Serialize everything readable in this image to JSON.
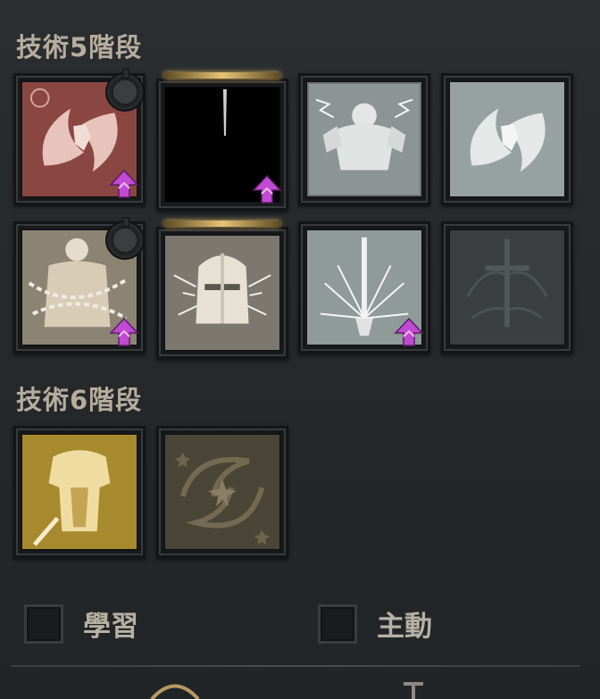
{
  "sections": [
    {
      "title": "技術5階段"
    },
    {
      "title": "技術6階段"
    }
  ],
  "skills_tier5": [
    {
      "name": "dragon-slash-skill-icon",
      "state": "active",
      "upgradable": true,
      "ring": true
    },
    {
      "name": "dark-blade-skill-icon",
      "state": "selected",
      "upgradable": true,
      "ring": false
    },
    {
      "name": "warrior-roar-skill-icon",
      "state": "available",
      "upgradable": false,
      "ring": false
    },
    {
      "name": "dragon-slash-alt-skill-icon",
      "state": "available",
      "upgradable": false,
      "ring": false
    },
    {
      "name": "chained-prisoner-skill-icon",
      "state": "active",
      "upgradable": true,
      "ring": true
    },
    {
      "name": "knight-helm-skill-icon",
      "state": "selected",
      "upgradable": false,
      "ring": false
    },
    {
      "name": "radiant-sword-skill-icon",
      "state": "available",
      "upgradable": true,
      "ring": false
    },
    {
      "name": "thorn-sword-skill-icon",
      "state": "locked",
      "upgradable": false,
      "ring": false
    }
  ],
  "skills_tier6": [
    {
      "name": "golden-armor-skill-icon",
      "state": "active"
    },
    {
      "name": "whirlwind-star-skill-icon",
      "state": "locked"
    }
  ],
  "filters": {
    "learn_label": "學習",
    "active_label": "主動"
  },
  "colors": {
    "upgrade_arrow": "#c04bd2",
    "gold_bar": "#e7c477"
  }
}
